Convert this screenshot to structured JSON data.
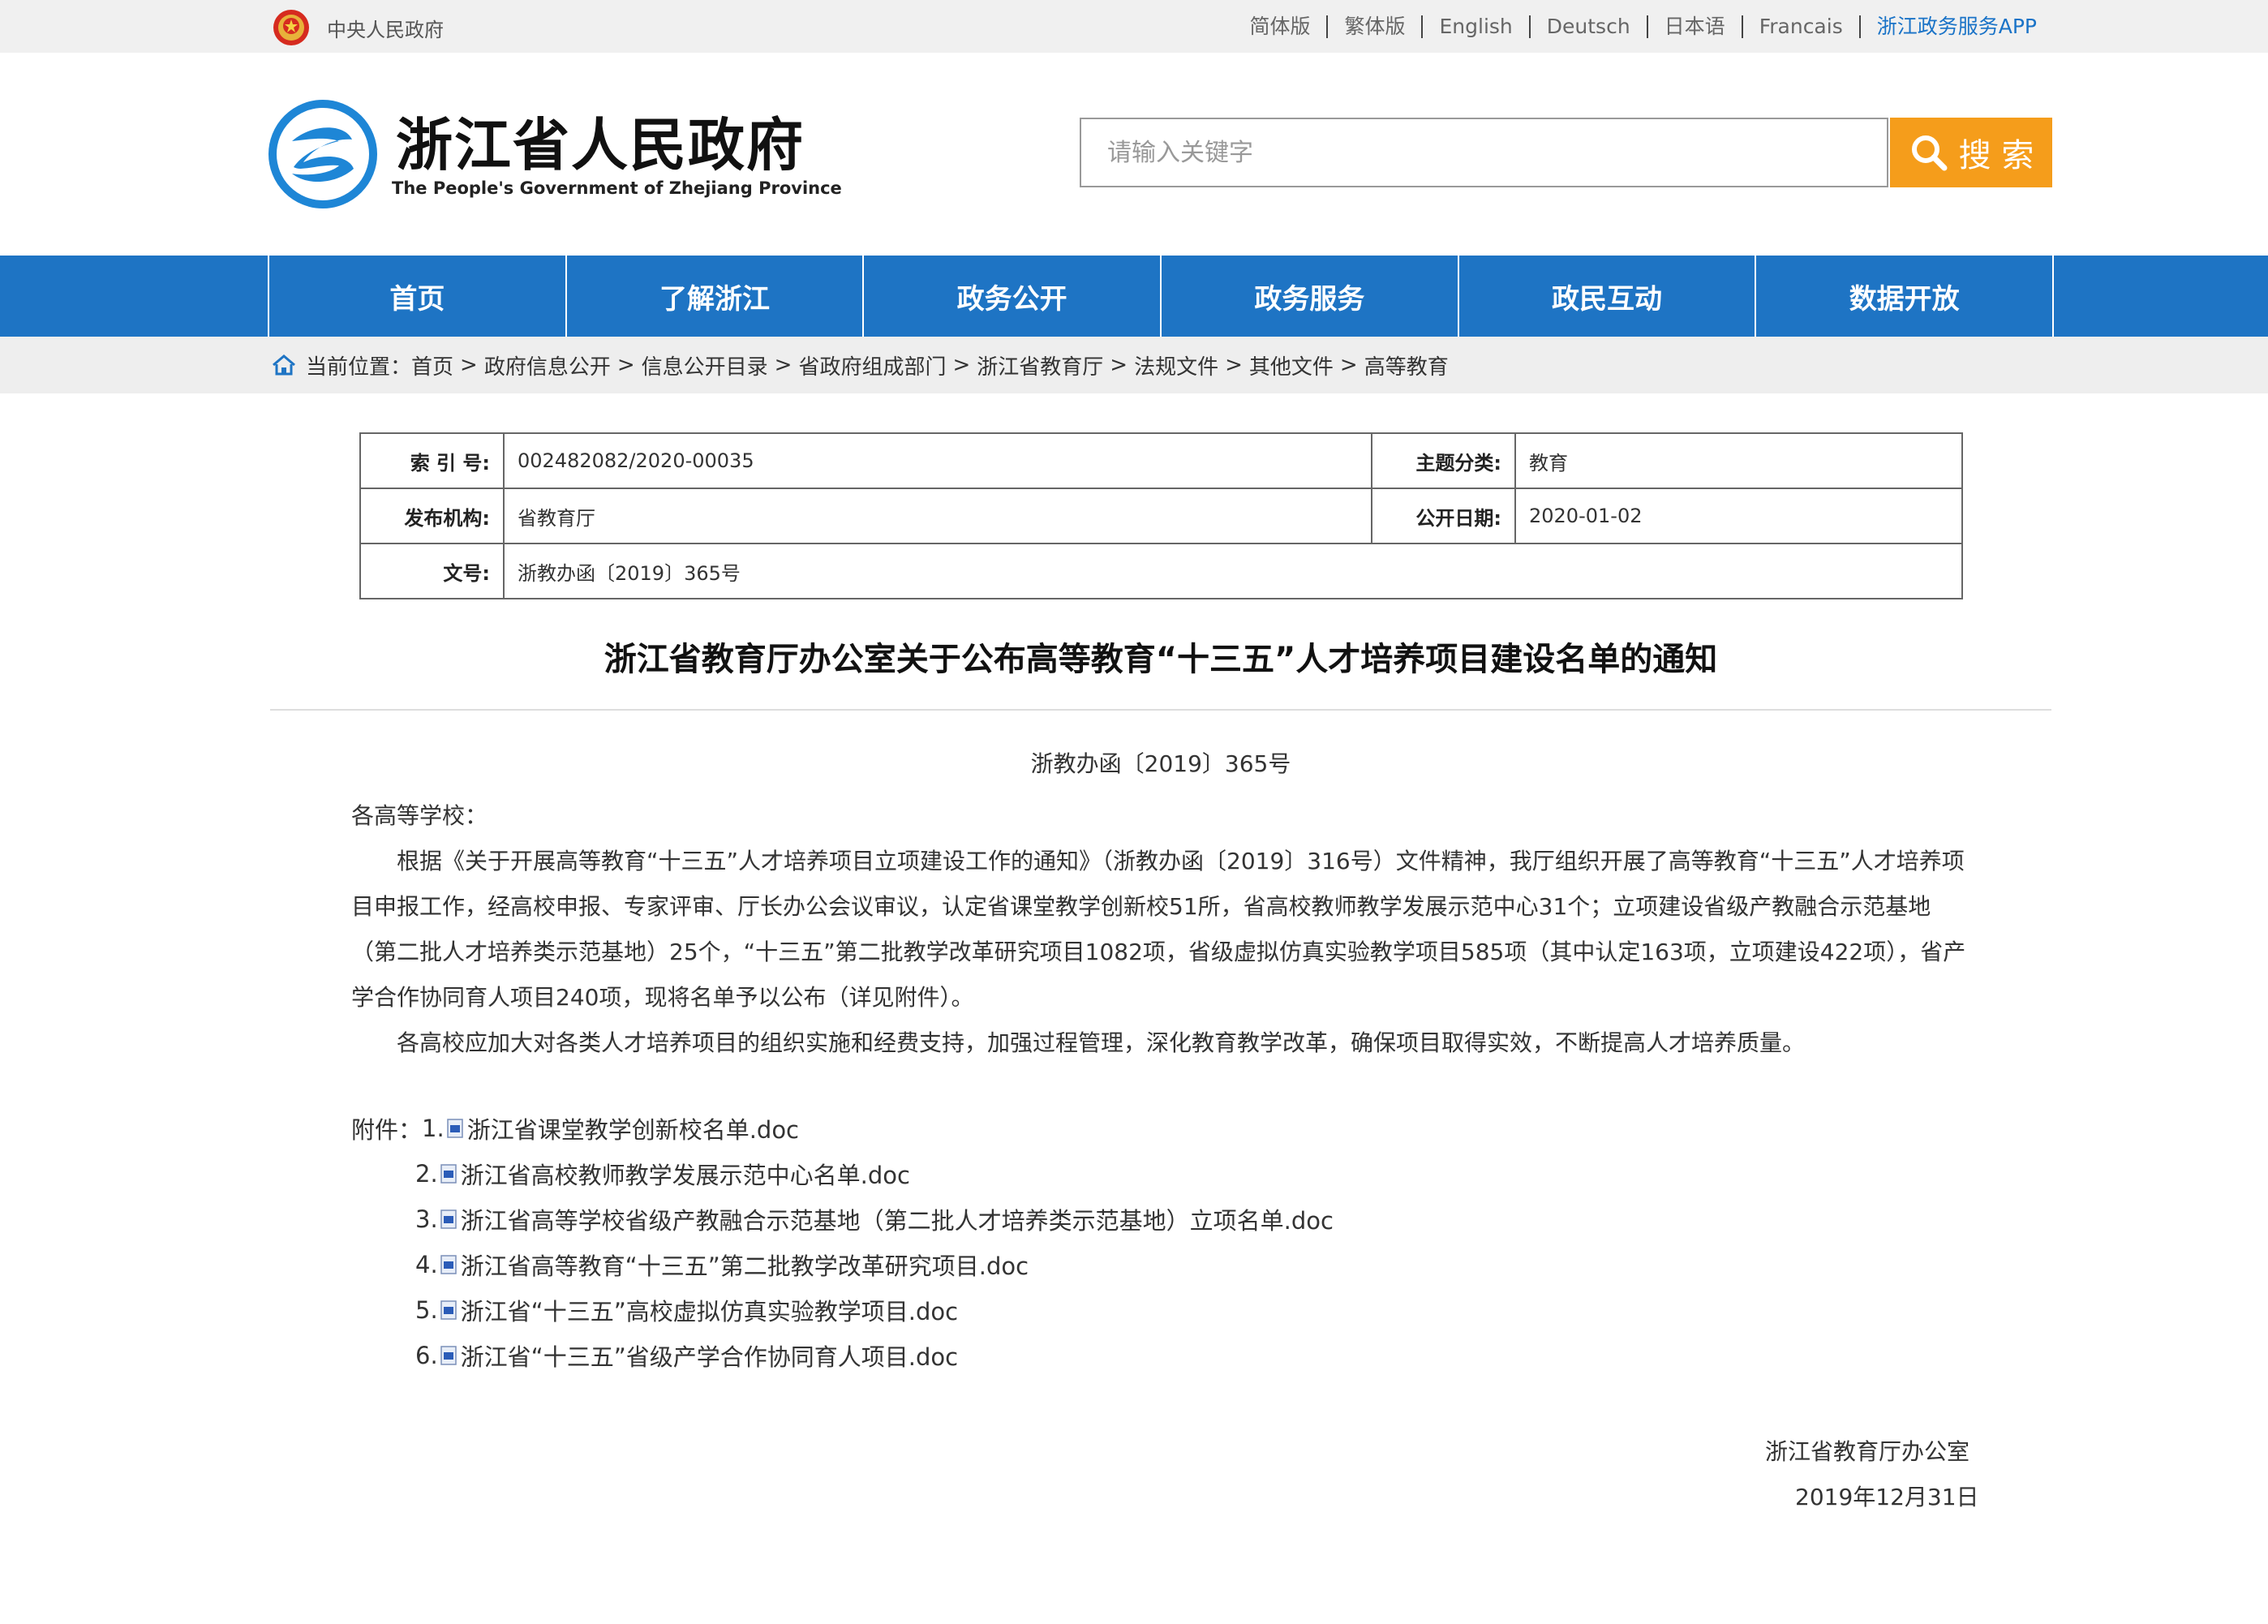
{
  "topbar": {
    "gov_link": "中央人民政府",
    "languages": [
      "简体版",
      "繁体版",
      "English",
      "Deutsch",
      "日本语",
      "Francais"
    ],
    "app_link": "浙江政务服务APP",
    "accent_color": "#1a73c7"
  },
  "header": {
    "site_title_cn": "浙江省人民政府",
    "site_title_en": "The People's Government of Zhejiang Province",
    "search_placeholder": "请输入关键字",
    "search_button": "搜 索",
    "search_button_color": "#f59d1b"
  },
  "nav": {
    "color": "#1e74c4",
    "items": [
      "首页",
      "了解浙江",
      "政务公开",
      "政务服务",
      "政民互动",
      "数据开放"
    ]
  },
  "breadcrumb": {
    "prefix": "当前位置：",
    "items": [
      "首页",
      "政府信息公开",
      "信息公开目录",
      "省政府组成部门",
      "浙江省教育厅",
      "法规文件",
      "其他文件",
      "高等教育"
    ]
  },
  "meta": {
    "index_label": "索 引 号:",
    "index_value": "002482082/2020-00035",
    "topic_label": "主题分类:",
    "topic_value": "教育",
    "issuer_label": "发布机构:",
    "issuer_value": "省教育厅",
    "date_label": "公开日期:",
    "date_value": "2020-01-02",
    "docno_label": "文号:",
    "docno_value": "浙教办函〔2019〕365号"
  },
  "article": {
    "title": "浙江省教育厅办公室关于公布高等教育“十三五”人才培养项目建设名单的通知",
    "doc_number": "浙教办函〔2019〕365号",
    "salutation": "各高等学校：",
    "paragraph_1": "根据《关于开展高等教育“十三五”人才培养项目立项建设工作的通知》（浙教办函〔2019〕316号）文件精神，我厅组织开展了高等教育“十三五”人才培养项目申报工作，经高校申报、专家评审、厅长办公会议审议，认定省课堂教学创新校51所，省高校教师教学发展示范中心31个；立项建设省级产教融合示范基地（第二批人才培养类示范基地）25个，“十三五”第二批教学改革研究项目1082项，省级虚拟仿真实验教学项目585项（其中认定163项，立项建设422项），省产学合作协同育人项目240项，现将名单予以公布（详见附件）。",
    "paragraph_2": "各高校应加大对各类人才培养项目的组织实施和经费支持，加强过程管理，深化教育教学改革，确保项目取得实效，不断提高人才培养质量。",
    "attachments_label": "附件：",
    "attachments": [
      {
        "num": "1.",
        "name": "浙江省课堂教学创新校名单.doc"
      },
      {
        "num": "2.",
        "name": "浙江省高校教师教学发展示范中心名单.doc"
      },
      {
        "num": "3.",
        "name": "浙江省高等学校省级产教融合示范基地（第二批人才培养类示范基地）立项名单.doc"
      },
      {
        "num": "4.",
        "name": "浙江省高等教育“十三五”第二批教学改革研究项目.doc"
      },
      {
        "num": "5.",
        "name": "浙江省“十三五”高校虚拟仿真实验教学项目.doc"
      },
      {
        "num": "6.",
        "name": "浙江省“十三五”省级产学合作协同育人项目.doc"
      }
    ],
    "signature_org": "浙江省教育厅办公室",
    "signature_date": "2019年12月31日"
  }
}
